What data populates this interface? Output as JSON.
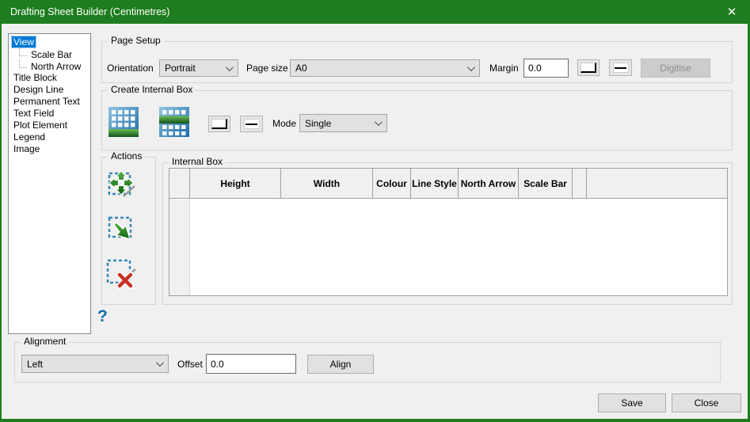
{
  "window": {
    "title": "Drafting Sheet Builder (Centimetres)",
    "accent_green": "#1e7d1e"
  },
  "icons": {
    "close": "✕",
    "help": "?"
  },
  "tree": {
    "items": [
      {
        "label": "View",
        "level": 0,
        "selected": true
      },
      {
        "label": "Scale Bar",
        "level": 1,
        "selected": false
      },
      {
        "label": "North Arrow",
        "level": 1,
        "selected": false
      },
      {
        "label": "Title Block",
        "level": 0,
        "selected": false
      },
      {
        "label": "Design Line",
        "level": 0,
        "selected": false
      },
      {
        "label": "Permanent Text",
        "level": 0,
        "selected": false
      },
      {
        "label": "Text Field",
        "level": 0,
        "selected": false
      },
      {
        "label": "Plot Element",
        "level": 0,
        "selected": false
      },
      {
        "label": "Legend",
        "level": 0,
        "selected": false
      },
      {
        "label": "Image",
        "level": 0,
        "selected": false
      }
    ]
  },
  "page_setup": {
    "title": "Page Setup",
    "orientation_label": "Orientation",
    "orientation_value": "Portrait",
    "page_size_label": "Page size",
    "page_size_value": "A0",
    "margin_label": "Margin",
    "margin_value": "0.0",
    "digitise_label": "Digitise",
    "digitise_enabled": false
  },
  "create_internal_box": {
    "title": "Create Internal Box",
    "mode_label": "Mode",
    "mode_value": "Single"
  },
  "actions": {
    "title": "Actions"
  },
  "internal_box": {
    "title": "Internal Box",
    "columns": [
      "",
      "Height",
      "Width",
      "Colour",
      "Line Style",
      "North Arrow",
      "Scale Bar",
      ""
    ],
    "rows": []
  },
  "alignment": {
    "title": "Alignment",
    "value": "Left",
    "offset_label": "Offset",
    "offset_value": "0.0",
    "align_label": "Align"
  },
  "footer": {
    "save_label": "Save",
    "close_label": "Close"
  }
}
